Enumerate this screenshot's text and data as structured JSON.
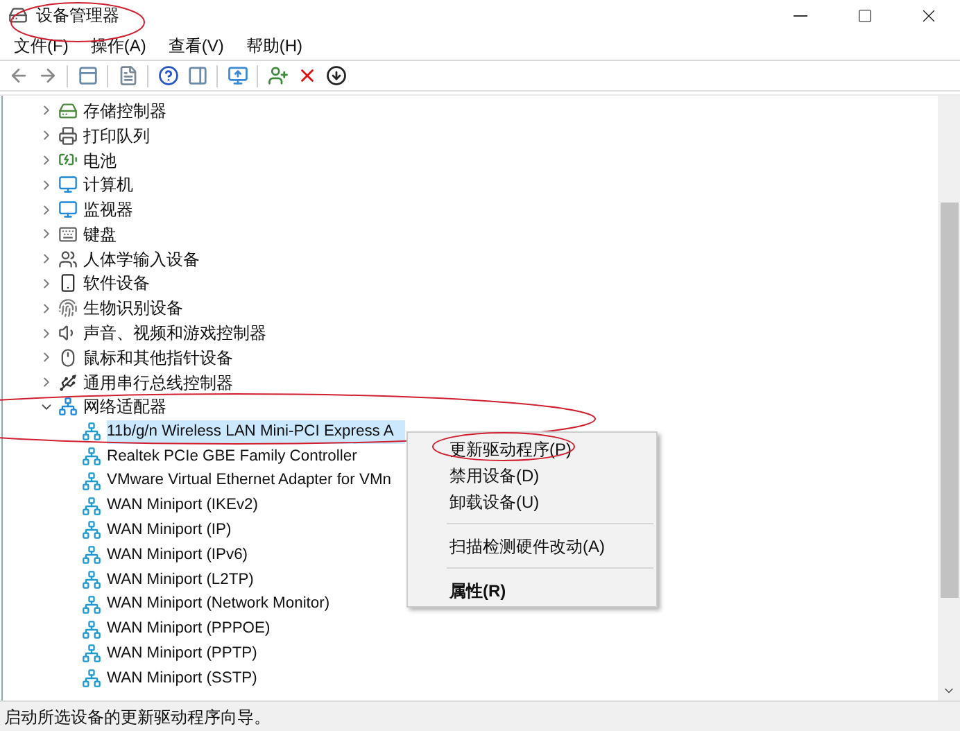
{
  "window": {
    "title": "设备管理器"
  },
  "menu_bar": [
    "文件(F)",
    "操作(A)",
    "查看(V)",
    "帮助(H)"
  ],
  "tree": {
    "items": [
      {
        "label": "存储控制器",
        "expanded": false
      },
      {
        "label": "打印队列",
        "expanded": false
      },
      {
        "label": "电池",
        "expanded": false
      },
      {
        "label": "计算机",
        "expanded": false
      },
      {
        "label": "监视器",
        "expanded": false
      },
      {
        "label": "键盘",
        "expanded": false
      },
      {
        "label": "人体学输入设备",
        "expanded": false
      },
      {
        "label": "软件设备",
        "expanded": false
      },
      {
        "label": "生物识别设备",
        "expanded": false
      },
      {
        "label": "声音、视频和游戏控制器",
        "expanded": false
      },
      {
        "label": "鼠标和其他指针设备",
        "expanded": false
      },
      {
        "label": "通用串行总线控制器",
        "expanded": false
      },
      {
        "label": "网络适配器",
        "expanded": true,
        "children": [
          {
            "label": "11b/g/n  Wireless LAN Mini-PCI Express A",
            "selected": true
          },
          {
            "label": "Realtek PCIe GBE Family Controller",
            "selected": false
          },
          {
            "label": "VMware Virtual Ethernet Adapter for VMn",
            "selected": false
          },
          {
            "label": "WAN Miniport (IKEv2)",
            "selected": false
          },
          {
            "label": "WAN Miniport (IP)",
            "selected": false
          },
          {
            "label": "WAN Miniport (IPv6)",
            "selected": false
          },
          {
            "label": "WAN Miniport (L2TP)",
            "selected": false
          },
          {
            "label": "WAN Miniport (Network Monitor)",
            "selected": false
          },
          {
            "label": "WAN Miniport (PPPOE)",
            "selected": false
          },
          {
            "label": "WAN Miniport (PPTP)",
            "selected": false
          },
          {
            "label": "WAN Miniport (SSTP)",
            "selected": false
          }
        ]
      }
    ]
  },
  "context_menu": {
    "items": [
      {
        "kind": "item",
        "label": "更新驱动程序(P)",
        "default": false
      },
      {
        "kind": "item",
        "label": "禁用设备(D)",
        "default": false
      },
      {
        "kind": "item",
        "label": "卸载设备(U)",
        "default": false
      },
      {
        "kind": "separator"
      },
      {
        "kind": "item",
        "label": "扫描检测硬件改动(A)",
        "default": false
      },
      {
        "kind": "separator"
      },
      {
        "kind": "item",
        "label": "属性(R)",
        "default": true
      }
    ]
  },
  "status_bar": {
    "text": "启动所选设备的更新驱动程序向导。"
  }
}
